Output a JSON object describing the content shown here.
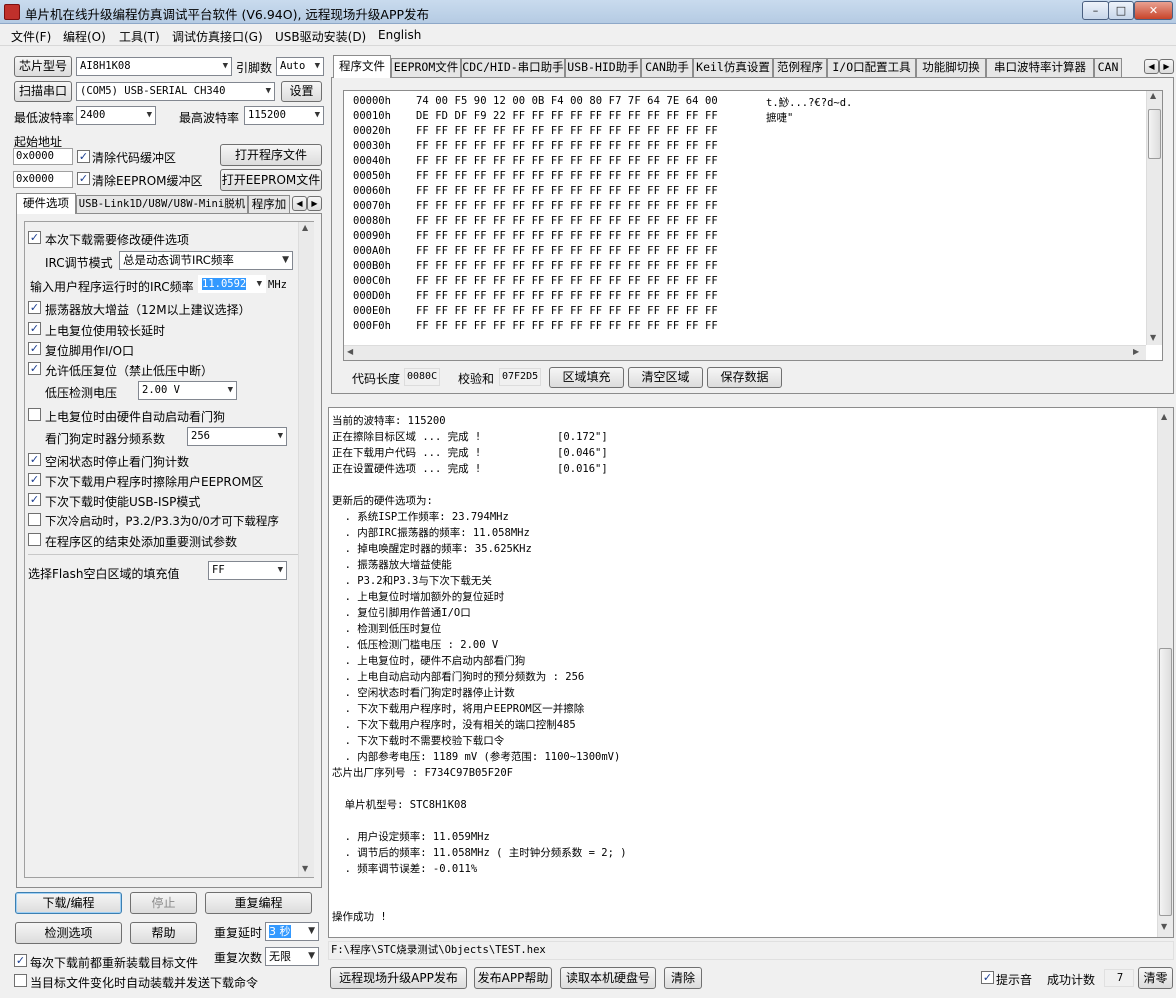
{
  "window": {
    "title": "单片机在线升级编程仿真调试平台软件 (V6.94O), 远程现场升级APP发布",
    "min": "–",
    "max": "□",
    "close": "✕"
  },
  "menu": [
    "文件(F)",
    "编程(O)",
    "工具(T)",
    "调试仿真接口(G)",
    "USB驱动安装(D)",
    "English"
  ],
  "left": {
    "chip_button": "芯片型号",
    "chip_value": "AI8H1K08",
    "pins_label": "引脚数",
    "pins_value": "Auto",
    "scan_button": "扫描串口",
    "port_value": "(COM5) USB-SERIAL CH340",
    "settings_button": "设置",
    "min_baud_label": "最低波特率",
    "min_baud": "2400",
    "max_baud_label": "最高波特率",
    "max_baud": "115200",
    "start_addr_label": "起始地址",
    "addr1": "0x0000",
    "clear_code_label": "清除代码缓冲区",
    "open_program_button": "打开程序文件",
    "addr2": "0x0000",
    "clear_eeprom_label": "清除EEPROM缓冲区",
    "open_eeprom_button": "打开EEPROM文件",
    "tabs": [
      "硬件选项",
      "USB-Link1D/U8W/U8W-Mini脱机",
      "程序加"
    ],
    "hw": {
      "modify_label": "本次下载需要修改硬件选项",
      "irc_mode_label": "IRC调节模式",
      "irc_mode_value": "总是动态调节IRC频率",
      "irc_freq_label": "输入用户程序运行时的IRC频率",
      "irc_freq_value": "11.0592",
      "irc_unit": "MHz",
      "osc_gain": "振荡器放大增益（12M以上建议选择）",
      "long_delay": "上电复位使用较长延时",
      "reset_io": "复位脚用作I/O口",
      "lvr": "允许低压复位（禁止低压中断）",
      "lvd_label": "低压检测电压",
      "lvd_value": "2.00 V",
      "wdt_auto": "上电复位时由硬件自动启动看门狗",
      "wdt_div_label": "看门狗定时器分频系数",
      "wdt_div_value": "256",
      "idle_wdt": "空闲状态时停止看门狗计数",
      "erase_eeprom": "下次下载用户程序时擦除用户EEPROM区",
      "usb_isp": "下次下载时使能USB-ISP模式",
      "cold_start": "下次冷启动时，P3.2/P3.3为0/0才可下载程序",
      "add_params": "在程序区的结束处添加重要测试参数",
      "fill_label": "选择Flash空白区域的填充值",
      "fill_value": "FF"
    },
    "download_button": "下载/编程",
    "stop_button": "停止",
    "repeat_button": "重复编程",
    "check_button": "检测选项",
    "help_button": "帮助",
    "repeat_delay_label": "重复延时",
    "repeat_delay_value": "3 秒",
    "repeat_count_label": "重复次数",
    "repeat_count_value": "无限",
    "reload_label": "每次下载前都重新装载目标文件",
    "auto_load_label": "当目标文件变化时自动装载并发送下载命令"
  },
  "right": {
    "tabs": [
      "程序文件",
      "EEPROM文件",
      "CDC/HID-串口助手",
      "USB-HID助手",
      "CAN助手",
      "Keil仿真设置",
      "范例程序",
      "I/O口配置工具",
      "功能脚切换",
      "串口波特率计算器",
      "CAN"
    ],
    "hex_rows": [
      {
        "addr": "00000h",
        "bytes": "74 00 F5 90 12 00 0B F4 00 80 F7 7F 64 7E 64 00",
        "ascii": "t.鯋...?€?d~d."
      },
      {
        "addr": "00010h",
        "bytes": "DE FD DF F9 22 FF FF FF FF FF FF FF FF FF FF FF",
        "ascii": "摭啑\""
      },
      {
        "addr": "00020h",
        "bytes": "FF FF FF FF FF FF FF FF FF FF FF FF FF FF FF FF",
        "ascii": ""
      },
      {
        "addr": "00030h",
        "bytes": "FF FF FF FF FF FF FF FF FF FF FF FF FF FF FF FF",
        "ascii": ""
      },
      {
        "addr": "00040h",
        "bytes": "FF FF FF FF FF FF FF FF FF FF FF FF FF FF FF FF",
        "ascii": ""
      },
      {
        "addr": "00050h",
        "bytes": "FF FF FF FF FF FF FF FF FF FF FF FF FF FF FF FF",
        "ascii": ""
      },
      {
        "addr": "00060h",
        "bytes": "FF FF FF FF FF FF FF FF FF FF FF FF FF FF FF FF",
        "ascii": ""
      },
      {
        "addr": "00070h",
        "bytes": "FF FF FF FF FF FF FF FF FF FF FF FF FF FF FF FF",
        "ascii": ""
      },
      {
        "addr": "00080h",
        "bytes": "FF FF FF FF FF FF FF FF FF FF FF FF FF FF FF FF",
        "ascii": ""
      },
      {
        "addr": "00090h",
        "bytes": "FF FF FF FF FF FF FF FF FF FF FF FF FF FF FF FF",
        "ascii": ""
      },
      {
        "addr": "000A0h",
        "bytes": "FF FF FF FF FF FF FF FF FF FF FF FF FF FF FF FF",
        "ascii": ""
      },
      {
        "addr": "000B0h",
        "bytes": "FF FF FF FF FF FF FF FF FF FF FF FF FF FF FF FF",
        "ascii": ""
      },
      {
        "addr": "000C0h",
        "bytes": "FF FF FF FF FF FF FF FF FF FF FF FF FF FF FF FF",
        "ascii": ""
      },
      {
        "addr": "000D0h",
        "bytes": "FF FF FF FF FF FF FF FF FF FF FF FF FF FF FF FF",
        "ascii": ""
      },
      {
        "addr": "000E0h",
        "bytes": "FF FF FF FF FF FF FF FF FF FF FF FF FF FF FF FF",
        "ascii": ""
      },
      {
        "addr": "000F0h",
        "bytes": "FF FF FF FF FF FF FF FF FF FF FF FF FF FF FF FF",
        "ascii": ""
      }
    ],
    "code_len_label": "代码长度",
    "code_len": "0080C",
    "checksum_label": "校验和",
    "checksum": "07F2D5",
    "fill_button": "区域填充",
    "clear_button": "清空区域",
    "save_button": "保存数据",
    "log": [
      "当前的波特率: 115200",
      "正在擦除目标区域 ... 完成 !            [0.172\"]",
      "正在下载用户代码 ... 完成 !            [0.046\"]",
      "正在设置硬件选项 ... 完成 !            [0.016\"]",
      "",
      "更新后的硬件选项为:",
      "  . 系统ISP工作频率: 23.794MHz",
      "  . 内部IRC振荡器的频率: 11.058MHz",
      "  . 掉电唤醒定时器的频率: 35.625KHz",
      "  . 振荡器放大增益使能",
      "  . P3.2和P3.3与下次下载无关",
      "  . 上电复位时增加额外的复位延时",
      "  . 复位引脚用作普通I/O口",
      "  . 检测到低压时复位",
      "  . 低压检测门槛电压 : 2.00 V",
      "  . 上电复位时，硬件不启动内部看门狗",
      "  . 上电自动启动内部看门狗时的预分频数为 : 256",
      "  . 空闲状态时看门狗定时器停止计数",
      "  . 下次下载用户程序时，将用户EEPROM区一并擦除",
      "  . 下次下载用户程序时，没有相关的端口控制485",
      "  . 下次下载时不需要校验下载口令",
      "  . 内部参考电压: 1189 mV (参考范围: 1100~1300mV)",
      "芯片出厂序列号 : F734C97B05F20F",
      "",
      "  单片机型号: STC8H1K08",
      "",
      "  . 用户设定频率: 11.059MHz",
      "  . 调节后的频率: 11.058MHz ( 主时钟分频系数 = 2; )",
      "  . 频率调节误差: -0.011%",
      "",
      "",
      "操作成功 !"
    ],
    "file_path": "F:\\程序\\STC烧录测试\\Objects\\TEST.hex",
    "remote_app_button": "远程现场升级APP发布",
    "app_help_button": "发布APP帮助",
    "read_disk_button": "读取本机硬盘号",
    "clear_log_button": "清除",
    "sound_label": "提示音",
    "success_count_label": "成功计数",
    "success_count": "7",
    "clear_count_button": "清零"
  }
}
